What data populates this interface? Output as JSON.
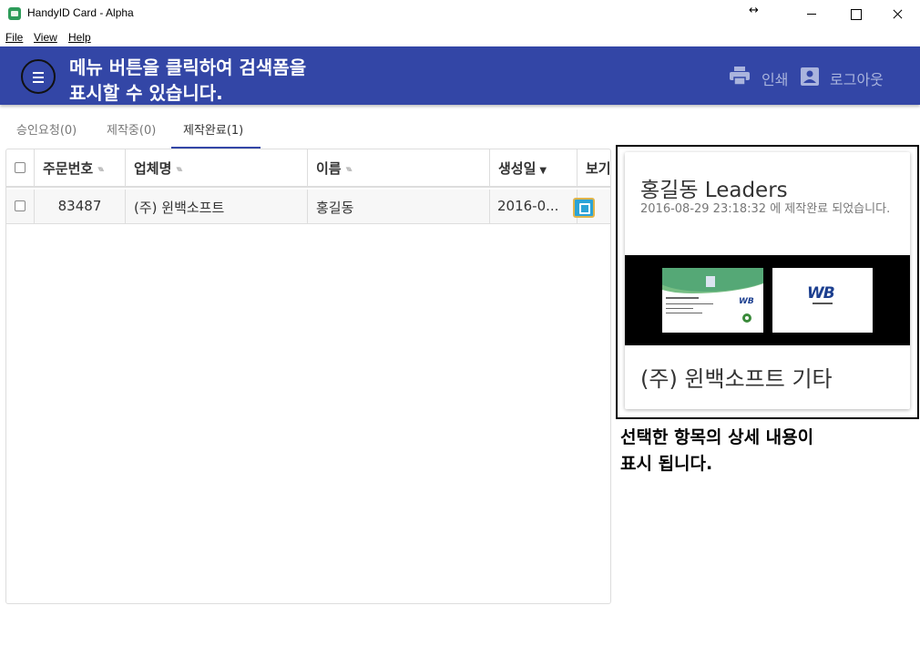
{
  "window": {
    "title": "HandyID Card - Alpha",
    "resize_glyph": "↔",
    "controls": [
      "minimize-icon",
      "maximize-icon",
      "close-icon"
    ]
  },
  "menu": {
    "file": "File",
    "view": "View",
    "help": "Help"
  },
  "header": {
    "background": "#3346a6",
    "menu_icon": "hamburger-icon",
    "overlay_line1": "메뉴 버튼을 클릭하여 검색폼을",
    "overlay_line2": "표시할 수 있습니다.",
    "print_icon": "printer-icon",
    "print_label": "인쇄",
    "account_icon": "account-box-icon",
    "logout_label": "로그아웃"
  },
  "tabs": [
    {
      "label": "승인요청(0)",
      "active": false
    },
    {
      "label": "제작중(0)",
      "active": false
    },
    {
      "label": "제작완료(1)",
      "active": true
    }
  ],
  "table": {
    "columns": [
      {
        "label": "주문번호",
        "sort": "none"
      },
      {
        "label": "업체명",
        "sort": "none"
      },
      {
        "label": "이름",
        "sort": "none"
      },
      {
        "label": "생성일",
        "sort": "desc"
      },
      {
        "label": "보기",
        "sort": "none"
      }
    ],
    "rows": [
      {
        "order_no": "83487",
        "company": "(주) 윈백소프트",
        "name": "홍길동",
        "created": "2016-0...",
        "view_icon": "edit-icon"
      }
    ]
  },
  "detail": {
    "title": "홍길동 Leaders",
    "subtitle": "2016-08-29 23:18:32 에 제작완료 되었습니다.",
    "company": "(주) 윈백소프트 기타",
    "front_logo": "WB",
    "back_logo": "WB",
    "overlay_line1": "선택한 항목의 상세 내용이",
    "overlay_line2": "표시 됩니다."
  }
}
